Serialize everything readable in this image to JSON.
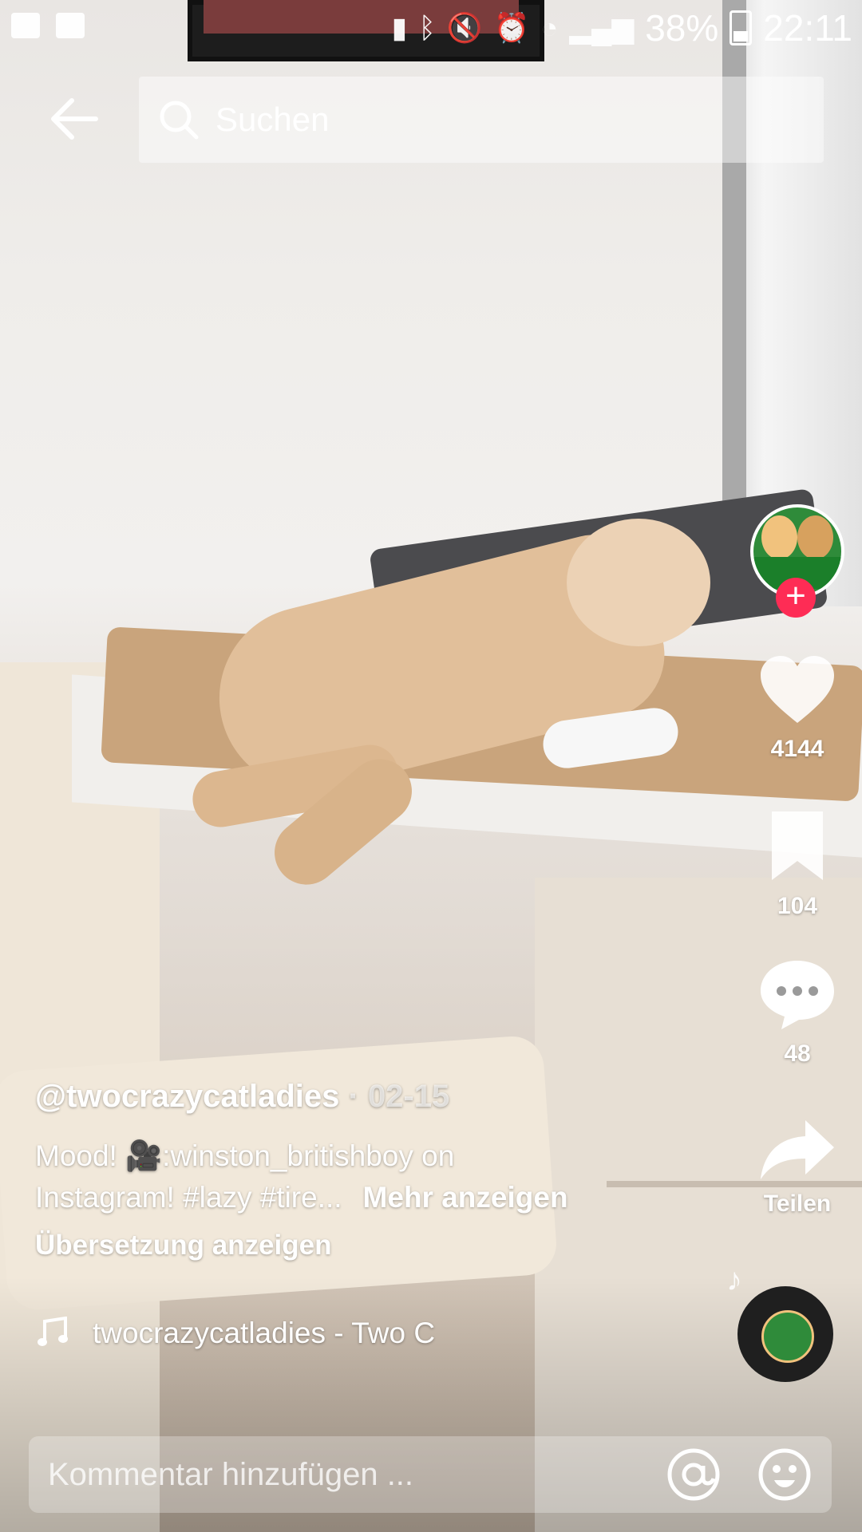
{
  "status_bar": {
    "battery": "38%",
    "time": "22:11"
  },
  "search": {
    "placeholder": "Suchen"
  },
  "rail": {
    "likes": "4144",
    "saves": "104",
    "comments": "48",
    "share_label": "Teilen"
  },
  "caption": {
    "username": "@twocrazycatladies",
    "date": " · 02-15",
    "text_line1": "Mood! 🎥:winston_britishboy on",
    "text_line2": "Instagram! #lazy #tire...",
    "more": "Mehr anzeigen",
    "translate": "Übersetzung anzeigen"
  },
  "music": {
    "track": "twocrazycatladies - Two C"
  },
  "comment_bar": {
    "placeholder": "Kommentar hinzufügen ..."
  },
  "icons": [
    "back-arrow-icon",
    "search-icon",
    "heart-icon",
    "bookmark-icon",
    "comment-icon",
    "share-icon",
    "music-note-icon",
    "at-icon",
    "emoji-icon"
  ]
}
